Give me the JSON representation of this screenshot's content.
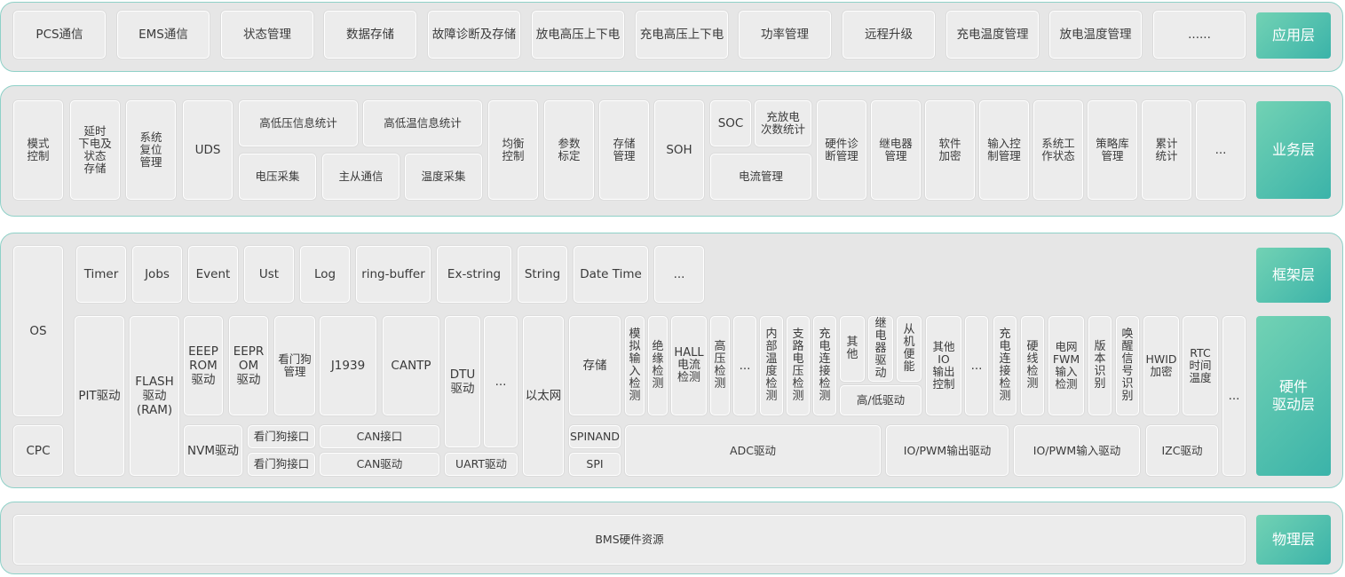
{
  "layers": {
    "app": "应用层",
    "business": "业务层",
    "framework": "框架层",
    "driver": "硬件\n驱动层",
    "physical": "物理层"
  },
  "app": [
    "PCS通信",
    "EMS通信",
    "状态管理",
    "数据存储",
    "故障诊断及存储",
    "放电高压上下电",
    "充电高压上下电",
    "功率管理",
    "远程升级",
    "充电温度管理",
    "放电温度管理",
    "......"
  ],
  "business": {
    "mode_ctrl": "模式\n控制",
    "delay_pd": "延时\n下电及\n状态\n存储",
    "sys_reset": "系统\n复位\n管理",
    "uds": "UDS",
    "hv_stats": "高低压信息统计",
    "temp_stats": "高低温信息统计",
    "volt_acq": "电压采集",
    "ms_comm": "主从通信",
    "temp_acq": "温度采集",
    "balance": "均衡\n控制",
    "param_cal": "参数\n标定",
    "storage": "存储\n管理",
    "soh": "SOH",
    "soc": "SOC",
    "cycle_stats": "充放电\n次数统计",
    "current_mgmt": "电流管理",
    "hw_diag": "硬件诊\n断管理",
    "relay_mgmt": "继电器\n管理",
    "sw_encrypt": "软件\n加密",
    "input_ctrl": "输入控\n制管理",
    "sys_state": "系统工\n作状态",
    "policy_lib": "策略库\n管理",
    "accum_stats": "累计\n统计",
    "more": "..."
  },
  "framework": {
    "os": "OS",
    "cpc": "CPC",
    "items": [
      "Timer",
      "Jobs",
      "Event",
      "Ust",
      "Log",
      "ring-buffer",
      "Ex-string",
      "String",
      "Date Time",
      "..."
    ]
  },
  "driver": {
    "pit": "PIT驱动",
    "flash": "FLASH\n驱动\n(RAM)",
    "eeeprom": "EEEP\nROM\n驱动",
    "eeprom": "EEPR\nOM\n驱动",
    "watchdog_mgmt": "看门狗\n管理",
    "j1939": "J1939",
    "cantp": "CANTP",
    "dtu": "DTU\n驱动",
    "dtu_more": "...",
    "ethernet": "以太网",
    "storage": "存储",
    "nvm": "NVM驱动",
    "wd_if1": "看门狗接口",
    "wd_if2": "看门狗接口",
    "can_if": "CAN接口",
    "can_drv": "CAN驱动",
    "uart": "UART驱动",
    "spinand": "SPINAND",
    "spi": "SPI",
    "analog_in": "模\n拟\n输\n入\n检\n测",
    "insulation": "绝\n缘\n检\n测",
    "hall": "HALL\n电流\n检测",
    "hv_detect": "高\n压\n检\n测",
    "adc_more": "...",
    "internal_temp": "内\n部\n温\n度\n检\n测",
    "branch_volt": "支\n路\n电\n压\n检\n测",
    "charge_conn1": "充\n电\n连\n接\n检\n测",
    "other": "其\n他",
    "relay_drv": "继\n电\n器\n驱\n动",
    "slave_power": "从\n机\n便\n能",
    "hl_drive": "高/低驱动",
    "other_io": "其他\nIO\n输出\n控制",
    "io_more": "...",
    "charge_conn2": "充\n电\n连\n接\n检\n测",
    "hardwire": "硬\n线\n检\n测",
    "grid_fwm": "电网\nFWM\n输入\n检测",
    "version": "版\n本\n识\n别",
    "wakeup": "唤\n醒\n信\n号\n识\n别",
    "hwid": "HWID\n加密",
    "rtc": "RTC\n时间\n温度",
    "more": "...",
    "adc": "ADC驱动",
    "io_pwm_out": "IO/PWM输出驱动",
    "io_pwm_in": "IO/PWM输入驱动",
    "izc": "IZC驱动"
  },
  "physical": {
    "bms": "BMS硬件资源"
  }
}
